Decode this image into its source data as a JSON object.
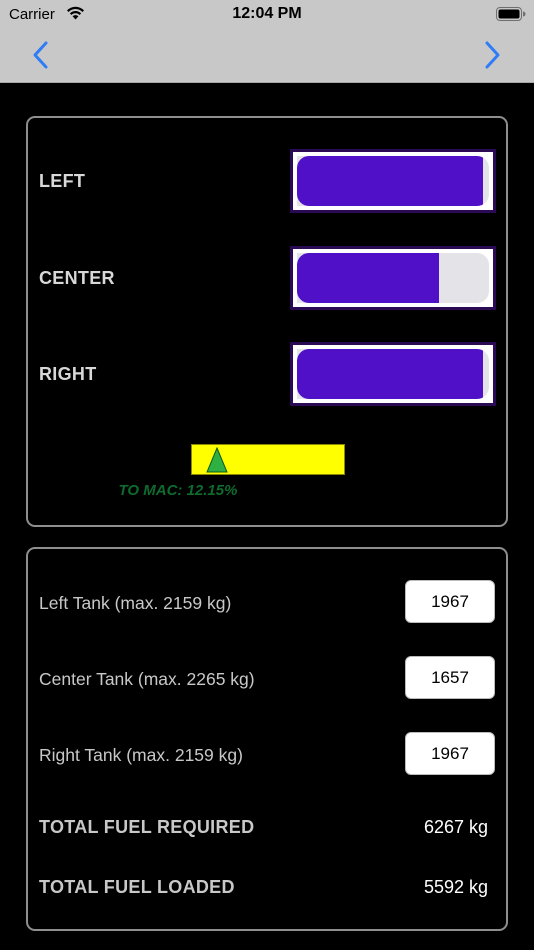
{
  "status_bar": {
    "carrier": "Carrier",
    "time": "12:04 PM"
  },
  "nav": {
    "back_icon": "chevron-left-icon",
    "forward_icon": "chevron-right-icon",
    "accent_color": "#2f7cf6"
  },
  "tanks": [
    {
      "label": "LEFT",
      "fill_fraction": 0.97
    },
    {
      "label": "CENTER",
      "fill_fraction": 0.74
    },
    {
      "label": "RIGHT",
      "fill_fraction": 0.97
    }
  ],
  "cg_indicator": {
    "label": "TO MAC: 12.15%",
    "marker_fraction": 0.11,
    "bar_color": "#ffff00",
    "marker_color": "#2fb043"
  },
  "colors": {
    "gauge_fill": "#5010c8",
    "gauge_frame": "#2a0a54",
    "panel_border": "#8e8e8e"
  },
  "fuel_inputs": [
    {
      "label": "Left Tank (max. 2159 kg)",
      "value": "1967"
    },
    {
      "label": "Center Tank (max. 2265 kg)",
      "value": "1657"
    },
    {
      "label": "Right Tank (max. 2159 kg)",
      "value": "1967"
    }
  ],
  "totals": {
    "required_label": "TOTAL FUEL REQUIRED",
    "required_value": "6267 kg",
    "loaded_label": "TOTAL FUEL LOADED",
    "loaded_value": "5592 kg"
  }
}
